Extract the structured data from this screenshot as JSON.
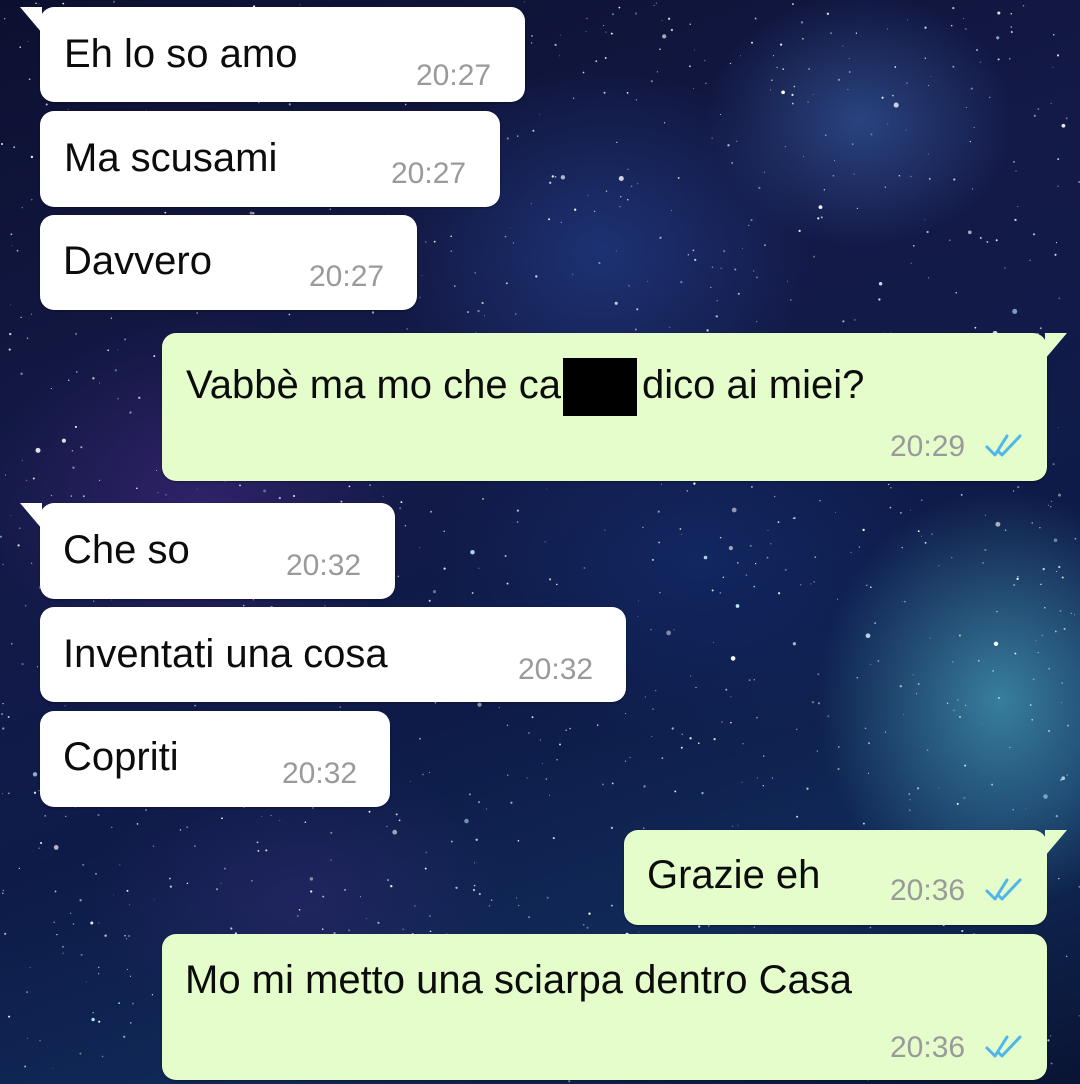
{
  "theme": {
    "incoming_bubble_color": "#ffffff",
    "outgoing_bubble_color": "#e4fdca",
    "read_tick_color": "#4fb6ec",
    "wallpaper": "starry-galaxy"
  },
  "messages": [
    {
      "direction": "incoming",
      "text": "Eh lo so amo",
      "time": "20:27"
    },
    {
      "direction": "incoming",
      "text": "Ma scusami",
      "time": "20:27"
    },
    {
      "direction": "incoming",
      "text": "Davvero",
      "time": "20:27"
    },
    {
      "direction": "outgoing",
      "text_before": "Vabbè ma mo che ca",
      "text_after": "dico ai miei?",
      "time": "20:29",
      "status_icon": "double-check-read-icon"
    },
    {
      "direction": "incoming",
      "text": "Che so",
      "time": "20:32"
    },
    {
      "direction": "incoming",
      "text": "Inventati una cosa",
      "time": "20:32"
    },
    {
      "direction": "incoming",
      "text": "Copriti",
      "time": "20:32"
    },
    {
      "direction": "outgoing",
      "text": "Grazie eh",
      "time": "20:36",
      "status_icon": "double-check-read-icon"
    },
    {
      "direction": "outgoing",
      "text": "Mo mi metto una sciarpa dentro Casa",
      "time": "20:36",
      "status_icon": "double-check-read-icon"
    }
  ]
}
